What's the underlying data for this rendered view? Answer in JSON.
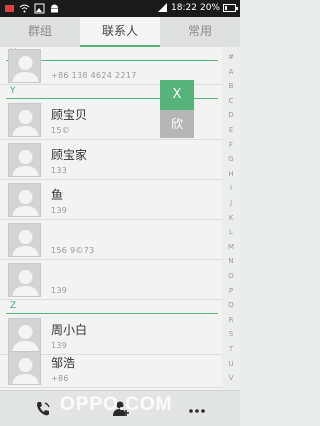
{
  "status_bar": {
    "time": "18:22",
    "battery_text": "20%",
    "battery_level": 0.2
  },
  "tabs": [
    {
      "label": "群组"
    },
    {
      "label": "联系人"
    },
    {
      "label": "常用"
    }
  ],
  "sections": [
    {
      "letter": "X"
    },
    {
      "letter": "Y"
    },
    {
      "letter": "Z"
    }
  ],
  "contacts": [
    {
      "name": "",
      "phone": "+86 138 4624 2217"
    },
    {
      "name": "顾宝贝",
      "phone": "15©"
    },
    {
      "name": "顾宝家",
      "phone": "133"
    },
    {
      "name": "鱼",
      "phone": "139"
    },
    {
      "name": "",
      "phone": "156 9©73"
    },
    {
      "name": "",
      "phone": "139"
    },
    {
      "name": "周小白",
      "phone": "139"
    },
    {
      "name": "邹浩",
      "phone": "+86"
    }
  ],
  "index_letters": [
    "#",
    "A",
    "B",
    "C",
    "D",
    "E",
    "F",
    "G",
    "H",
    "I",
    "J",
    "K",
    "L",
    "M",
    "N",
    "O",
    "P",
    "Q",
    "R",
    "S",
    "T",
    "U",
    "V",
    "W",
    "X",
    "Y",
    "Z"
  ],
  "index_highlight": [
    "X",
    "Y"
  ],
  "popup": {
    "letter": "X",
    "sub": "欣"
  },
  "watermark": "OPPO.COM",
  "colors": {
    "accent": "#56b47a",
    "status_bar": "#1a1a1a"
  }
}
